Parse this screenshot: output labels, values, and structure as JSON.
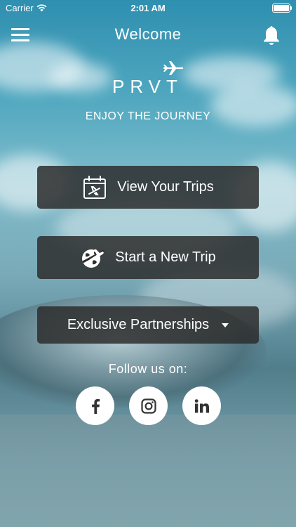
{
  "status_bar": {
    "carrier": "Carrier",
    "time": "2:01 AM"
  },
  "nav": {
    "title": "Welcome",
    "menu_icon": "hamburger-menu-icon",
    "notifications_icon": "bell-icon"
  },
  "brand": {
    "logo": "PRVT",
    "tagline": "ENJOY THE JOURNEY"
  },
  "menu": {
    "view_trips": "View Your Trips",
    "new_trip": "Start a New Trip",
    "partnerships": "Exclusive Partnerships"
  },
  "social": {
    "label": "Follow us on:",
    "links": [
      "facebook",
      "instagram",
      "linkedin"
    ]
  },
  "colors": {
    "button_bg": "#2d2d2d",
    "text": "#ffffff",
    "social_icon": "#333333"
  }
}
